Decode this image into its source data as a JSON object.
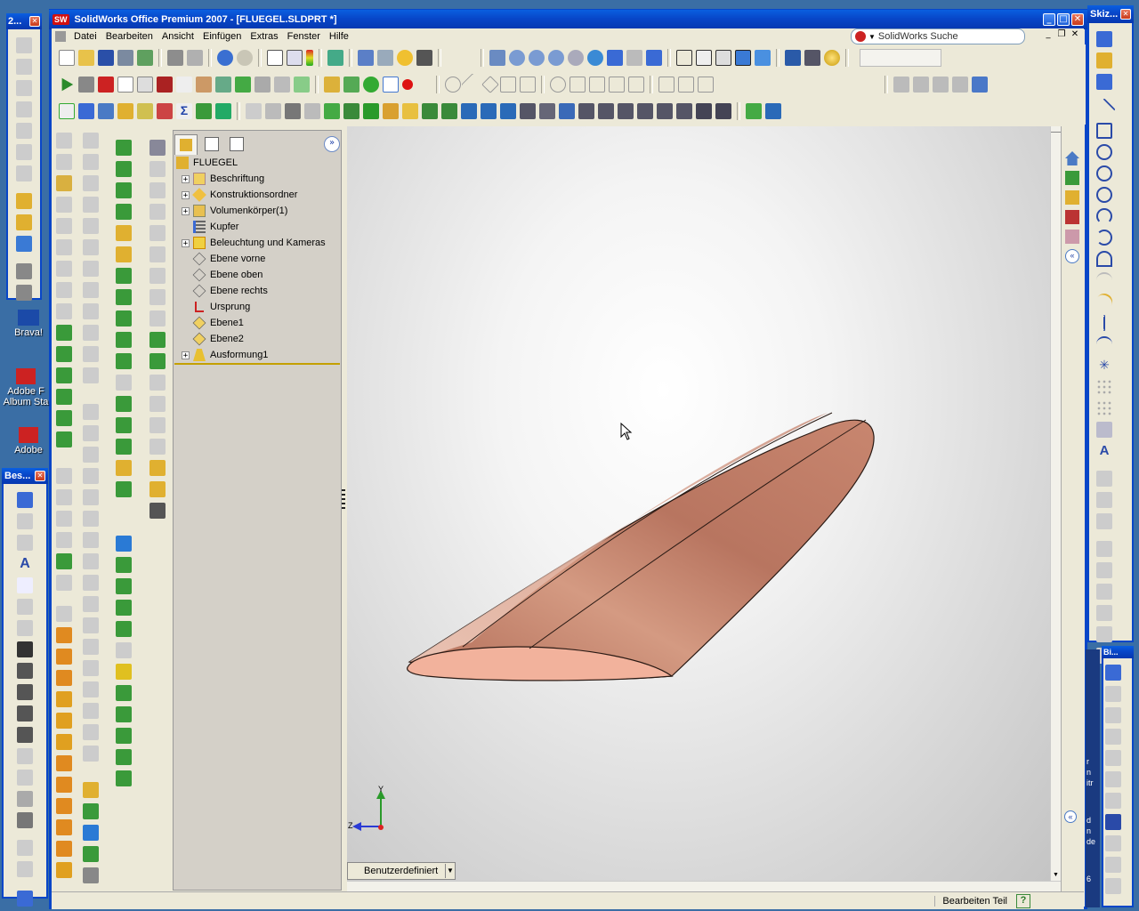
{
  "app": {
    "title": "SolidWorks Office Premium 2007 - [FLUEGEL.SLDPRT *]",
    "app_icon_text": "SW"
  },
  "menu": [
    "Datei",
    "Bearbeiten",
    "Ansicht",
    "Einfügen",
    "Extras",
    "Fenster",
    "Hilfe"
  ],
  "search": {
    "label": "SolidWorks Suche"
  },
  "desktop": {
    "icons": [
      {
        "label": "Brava!"
      },
      {
        "label": "Adobe F Album Sta"
      },
      {
        "label": "Adobe"
      }
    ]
  },
  "floating": {
    "left_top_title": "2...",
    "left_bottom_title": "Bes...",
    "right_top_title": "Skiz...",
    "right_bottom_title": "Bi..."
  },
  "tree": {
    "root": "FLUEGEL",
    "items": [
      {
        "label": "Beschriftung",
        "expandable": true,
        "icon": "annotation-icon"
      },
      {
        "label": "Konstruktionsordner",
        "expandable": true,
        "icon": "design-folder-icon"
      },
      {
        "label": "Volumenkörper(1)",
        "expandable": true,
        "icon": "solid-bodies-icon"
      },
      {
        "label": "Kupfer",
        "expandable": false,
        "icon": "material-icon"
      },
      {
        "label": "Beleuchtung und Kameras",
        "expandable": true,
        "icon": "lights-icon"
      },
      {
        "label": "Ebene vorne",
        "expandable": false,
        "icon": "plane-icon"
      },
      {
        "label": "Ebene oben",
        "expandable": false,
        "icon": "plane-icon"
      },
      {
        "label": "Ebene rechts",
        "expandable": false,
        "icon": "plane-icon"
      },
      {
        "label": "Ursprung",
        "expandable": false,
        "icon": "origin-icon"
      },
      {
        "label": "Ebene1",
        "expandable": false,
        "icon": "plane-icon"
      },
      {
        "label": "Ebene2",
        "expandable": false,
        "icon": "plane-icon"
      },
      {
        "label": "Ausformung1",
        "expandable": true,
        "icon": "loft-icon"
      }
    ]
  },
  "viewport": {
    "view_dropdown": "Benutzerdefiniert",
    "triad": {
      "y": "Y",
      "z": "Z"
    }
  },
  "status": {
    "text": "Bearbeiten Teil",
    "help": "?"
  },
  "colors": {
    "model": "#c47f6b",
    "model_face": "#f2b29c",
    "accent": "#0846c8"
  },
  "right_desktop_glyphs": [
    "r",
    "n",
    "itr",
    "d",
    "n",
    "de",
    "6"
  ]
}
